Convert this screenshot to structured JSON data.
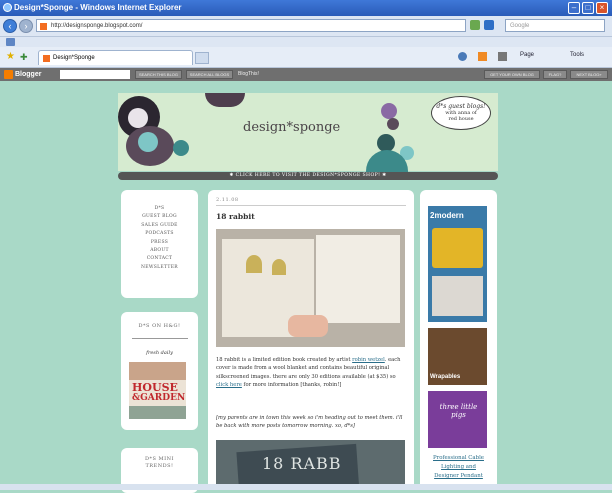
{
  "browser": {
    "window_title": "Design*Sponge - Windows Internet Explorer",
    "url": "http://designsponge.blogspot.com/",
    "search_placeholder": "Google",
    "tab_title": "Design*Sponge",
    "commands": [
      "Page",
      "Tools"
    ]
  },
  "blogger_bar": {
    "logo": "Blogger",
    "search_this_blog": "SEARCH THIS BLOG",
    "search_all_blogs": "SEARCH ALL BLOGS",
    "blog_this": "BlogThis!",
    "get_own_blog": "GET YOUR OWN BLOG",
    "flag": "FLAG?",
    "next_blog": "NEXT BLOG»"
  },
  "header": {
    "logo_text": "design*sponge",
    "bubble_title": "d*s guest blogs!",
    "bubble_line1": "with anna of",
    "bubble_line2": "red house",
    "shop_banner": "CLICK HERE TO VISIT THE DESIGN*SPONGE SHOP!"
  },
  "nav": {
    "items": [
      "D*S",
      "GUEST BLOG",
      "SALES GUIDE",
      "PODCASTS",
      "PRESS",
      "ABOUT",
      "CONTACT",
      "NEWSLETTER"
    ]
  },
  "hg": {
    "title": "D*S ON H&G!",
    "fresh_daily": "fresh daily",
    "img_line1": "HOUSE",
    "img_line2": "&GARDEN"
  },
  "mini": {
    "title_line1": "D*S MINI",
    "title_line2": "TRENDS!"
  },
  "post": {
    "date": "2.11.08",
    "title": "18 rabbit",
    "body_before_link1": "18 rabbit is a limited edition book created by artist ",
    "link1": "robin wetzel",
    "body_mid": ". each cover is made from a wool blanket and contains beautiful original silkscreened images. there are only 30 editions available (at $35) so ",
    "link2": "click here",
    "body_after": " for more information [thanks, robin!]",
    "note": "[my parents are in town this week so i'm heading out to meet them. i'll be back with more posts tomorrow morning. xo, d*s]",
    "cover_text": "18 RABB"
  },
  "ads": {
    "modern_logo": "2modern",
    "wrapables": "Wrapables",
    "three_little_pigs": "three little pigs",
    "link_line1": "Professional Cable",
    "link_line2": "Lighting and",
    "link_line3": "Designer Pendant"
  }
}
